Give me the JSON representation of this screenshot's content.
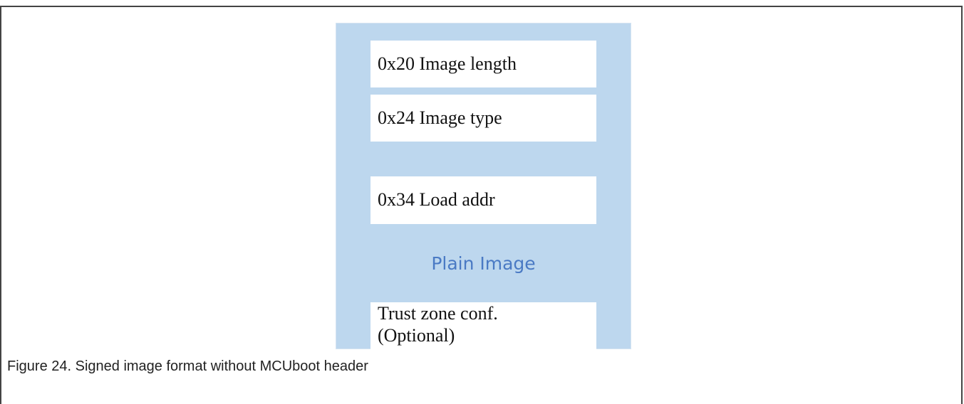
{
  "figure": {
    "fields": [
      "0x20 Image length",
      "0x24 Image type",
      "0x34 Load addr"
    ],
    "plain_image_label": "Plain Image",
    "trust_zone": {
      "line1": "Trust zone conf.",
      "line2": "(Optional)"
    },
    "caption": "Figure 24.  Signed image format without MCUboot header"
  }
}
